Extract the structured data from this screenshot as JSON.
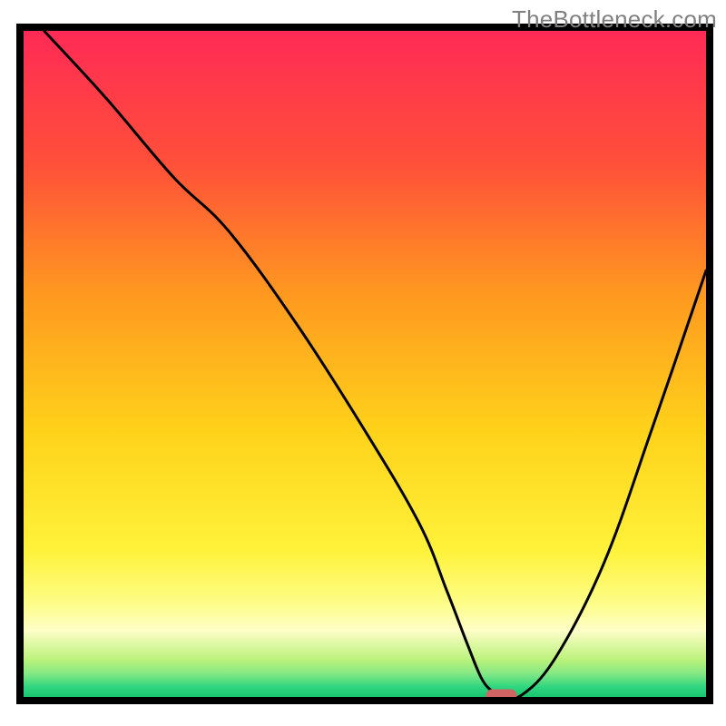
{
  "watermark": "TheBottleneck.com",
  "chart_data": {
    "type": "line",
    "title": "",
    "xlabel": "",
    "ylabel": "",
    "xlim": [
      0,
      100
    ],
    "ylim": [
      0,
      100
    ],
    "grid": false,
    "legend": false,
    "background": {
      "type": "vertical-gradient",
      "stops": [
        {
          "pos": 0.0,
          "color": "#ff2a55"
        },
        {
          "pos": 0.2,
          "color": "#ff5039"
        },
        {
          "pos": 0.4,
          "color": "#ff9a1f"
        },
        {
          "pos": 0.6,
          "color": "#ffd21a"
        },
        {
          "pos": 0.78,
          "color": "#fff23a"
        },
        {
          "pos": 0.86,
          "color": "#fdfd88"
        },
        {
          "pos": 0.9,
          "color": "#fefec8"
        },
        {
          "pos": 0.945,
          "color": "#b9f27a"
        },
        {
          "pos": 0.965,
          "color": "#83e884"
        },
        {
          "pos": 0.985,
          "color": "#2fd67f"
        },
        {
          "pos": 1.0,
          "color": "#19c56f"
        }
      ]
    },
    "series": [
      {
        "name": "bottleneck-curve",
        "x": [
          3,
          12,
          22,
          30,
          40,
          50,
          58,
          62,
          65,
          67,
          68.5,
          70,
          73,
          78,
          85,
          92,
          100
        ],
        "y": [
          100,
          90,
          78,
          70,
          56,
          40,
          26,
          16,
          8,
          3,
          1,
          0.3,
          0.3,
          6,
          20,
          40,
          64
        ]
      }
    ],
    "marker": {
      "name": "optimal-point",
      "x": 70,
      "y": 0.2,
      "color": "#d06464",
      "shape": "pill"
    },
    "frame_color": "#000000"
  }
}
